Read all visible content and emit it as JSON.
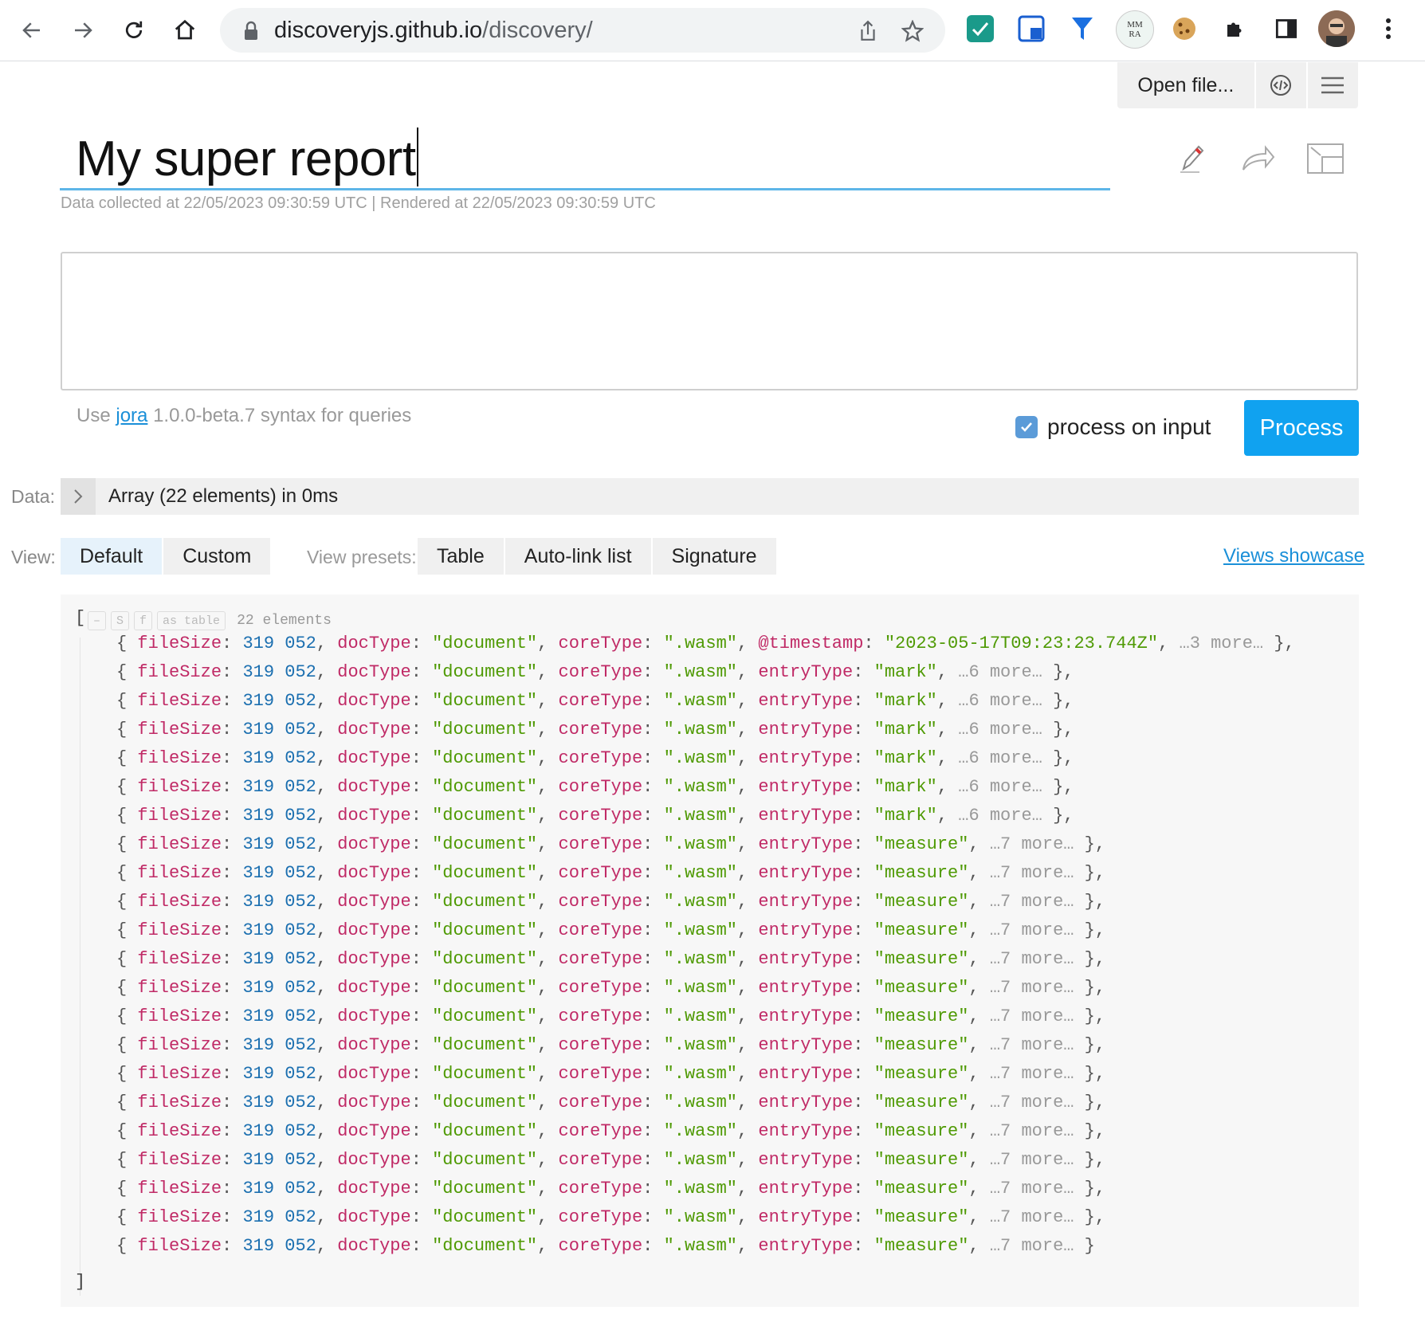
{
  "browser": {
    "url_host": "discoveryjs.github.io",
    "url_path": "/discovery/",
    "profile_badge_text": "MM\nRA"
  },
  "toolbar": {
    "open_file_label": "Open file...",
    "icons": [
      "code-icon",
      "menu-icon"
    ]
  },
  "report": {
    "title": "My super report",
    "meta": "Data collected at 22/05/2023 09:30:59 UTC | Rendered at 22/05/2023 09:30:59 UTC"
  },
  "query": {
    "value": "",
    "hint_prefix": "Use",
    "hint_link": "jora",
    "hint_suffix": "1.0.0-beta.7 syntax for queries",
    "process_on_input_label": "process on input",
    "process_on_input_checked": true,
    "process_label": "Process"
  },
  "data_bar": {
    "label": "Data:",
    "summary": "Array (22 elements) in 0ms"
  },
  "view": {
    "label": "View:",
    "tabs": [
      "Default",
      "Custom"
    ],
    "active_tab": "Default",
    "presets_label": "View presets:",
    "presets": [
      "Table",
      "Auto-link list",
      "Signature"
    ],
    "showcase_label": "Views showcase"
  },
  "output": {
    "open_bracket": "[",
    "close_bracket": "]",
    "tool_buttons": [
      "–",
      "S",
      "f",
      "as table"
    ],
    "count_label": "22 elements",
    "common": {
      "fileSize_key": "fileSize",
      "fileSize_value": "319 052",
      "docType_key": "docType",
      "docType_value": "\"document\"",
      "coreType_key": "coreType",
      "coreType_value": "\".wasm\""
    },
    "rows": [
      {
        "key4": "@timestamp",
        "val4": "\"2023-05-17T09:23:23.744Z\"",
        "more": "…3 more…",
        "end": "},"
      },
      {
        "key4": "entryType",
        "val4": "\"mark\"",
        "more": "…6 more…",
        "end": "},"
      },
      {
        "key4": "entryType",
        "val4": "\"mark\"",
        "more": "…6 more…",
        "end": "},"
      },
      {
        "key4": "entryType",
        "val4": "\"mark\"",
        "more": "…6 more…",
        "end": "},"
      },
      {
        "key4": "entryType",
        "val4": "\"mark\"",
        "more": "…6 more…",
        "end": "},"
      },
      {
        "key4": "entryType",
        "val4": "\"mark\"",
        "more": "…6 more…",
        "end": "},"
      },
      {
        "key4": "entryType",
        "val4": "\"mark\"",
        "more": "…6 more…",
        "end": "},"
      },
      {
        "key4": "entryType",
        "val4": "\"measure\"",
        "more": "…7 more…",
        "end": "},"
      },
      {
        "key4": "entryType",
        "val4": "\"measure\"",
        "more": "…7 more…",
        "end": "},"
      },
      {
        "key4": "entryType",
        "val4": "\"measure\"",
        "more": "…7 more…",
        "end": "},"
      },
      {
        "key4": "entryType",
        "val4": "\"measure\"",
        "more": "…7 more…",
        "end": "},"
      },
      {
        "key4": "entryType",
        "val4": "\"measure\"",
        "more": "…7 more…",
        "end": "},"
      },
      {
        "key4": "entryType",
        "val4": "\"measure\"",
        "more": "…7 more…",
        "end": "},"
      },
      {
        "key4": "entryType",
        "val4": "\"measure\"",
        "more": "…7 more…",
        "end": "},"
      },
      {
        "key4": "entryType",
        "val4": "\"measure\"",
        "more": "…7 more…",
        "end": "},"
      },
      {
        "key4": "entryType",
        "val4": "\"measure\"",
        "more": "…7 more…",
        "end": "},"
      },
      {
        "key4": "entryType",
        "val4": "\"measure\"",
        "more": "…7 more…",
        "end": "},"
      },
      {
        "key4": "entryType",
        "val4": "\"measure\"",
        "more": "…7 more…",
        "end": "},"
      },
      {
        "key4": "entryType",
        "val4": "\"measure\"",
        "more": "…7 more…",
        "end": "},"
      },
      {
        "key4": "entryType",
        "val4": "\"measure\"",
        "more": "…7 more…",
        "end": "},"
      },
      {
        "key4": "entryType",
        "val4": "\"measure\"",
        "more": "…7 more…",
        "end": "},"
      },
      {
        "key4": "entryType",
        "val4": "\"measure\"",
        "more": "…7 more…",
        "end": "}"
      }
    ]
  },
  "colors": {
    "accent": "#10a2f0",
    "key": "#c02a66",
    "number": "#1b6fb0",
    "string": "#4f9a04"
  }
}
